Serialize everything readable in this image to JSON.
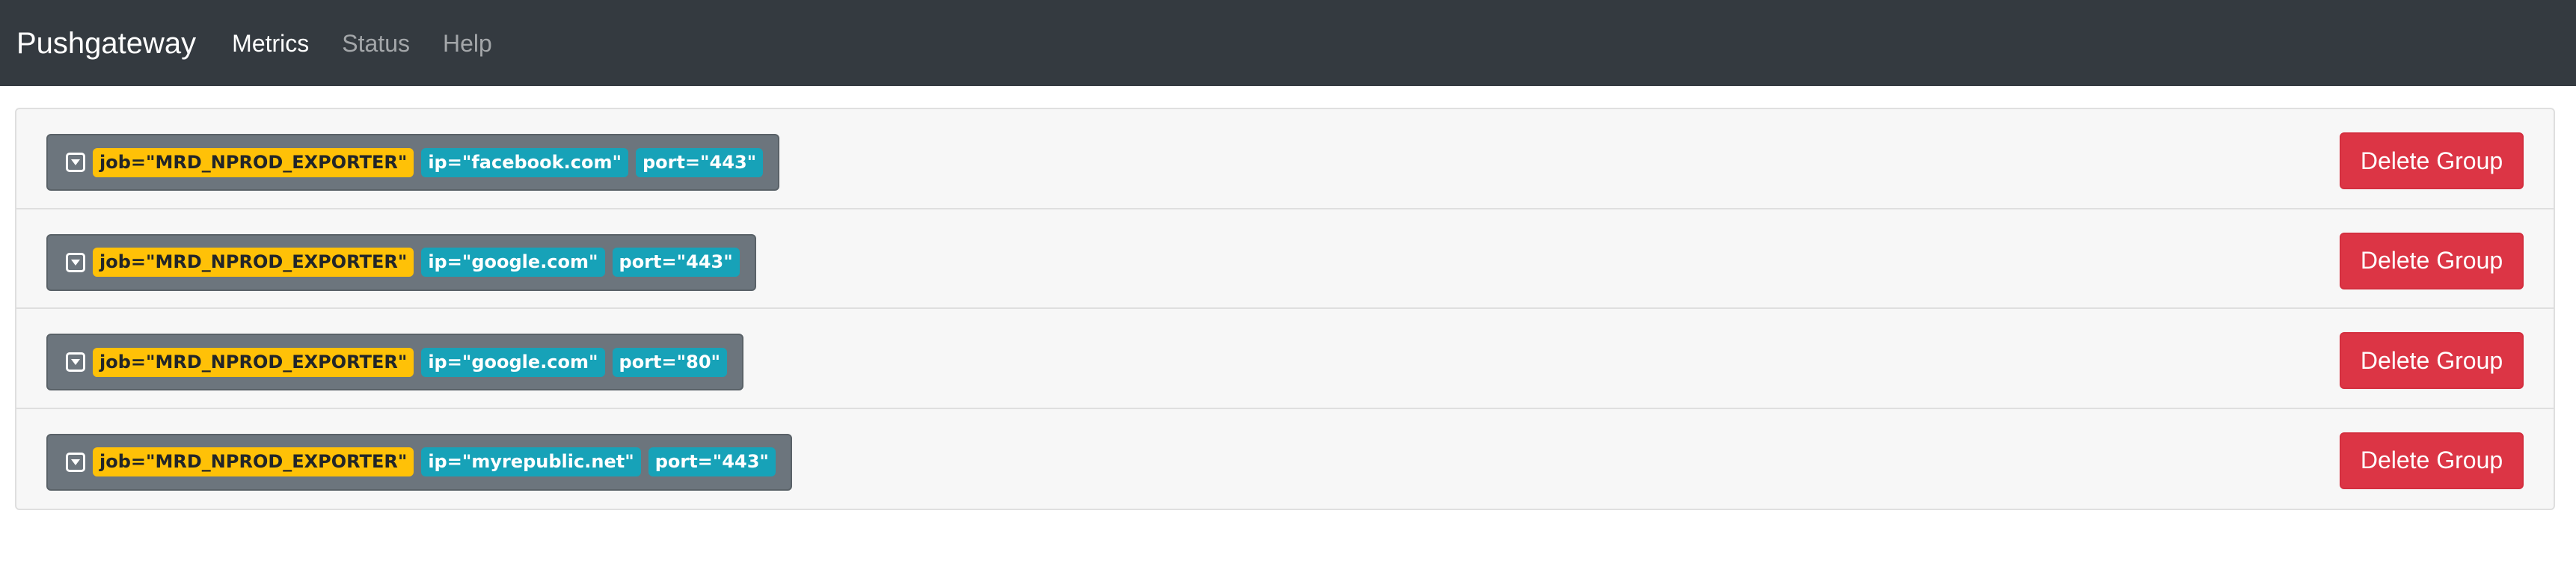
{
  "navbar": {
    "brand": "Pushgateway",
    "links": [
      {
        "label": "Metrics",
        "active": true
      },
      {
        "label": "Status",
        "active": false
      },
      {
        "label": "Help",
        "active": false
      }
    ]
  },
  "colors": {
    "navbar_bg": "#343a40",
    "job_badge": "#ffc107",
    "info_badge": "#17a2b8",
    "label_box": "#6c757d",
    "delete_button": "#dc3545"
  },
  "groups": [
    {
      "toggle_icon": "caret-down-square-icon",
      "job": "job=\"MRD_NPROD_EXPORTER\"",
      "ip": "ip=\"facebook.com\"",
      "port": "port=\"443\"",
      "delete_label": "Delete Group"
    },
    {
      "toggle_icon": "caret-down-square-icon",
      "job": "job=\"MRD_NPROD_EXPORTER\"",
      "ip": "ip=\"google.com\"",
      "port": "port=\"443\"",
      "delete_label": "Delete Group"
    },
    {
      "toggle_icon": "caret-down-square-icon",
      "job": "job=\"MRD_NPROD_EXPORTER\"",
      "ip": "ip=\"google.com\"",
      "port": "port=\"80\"",
      "delete_label": "Delete Group"
    },
    {
      "toggle_icon": "caret-down-square-icon",
      "job": "job=\"MRD_NPROD_EXPORTER\"",
      "ip": "ip=\"myrepublic.net\"",
      "port": "port=\"443\"",
      "delete_label": "Delete Group"
    }
  ]
}
